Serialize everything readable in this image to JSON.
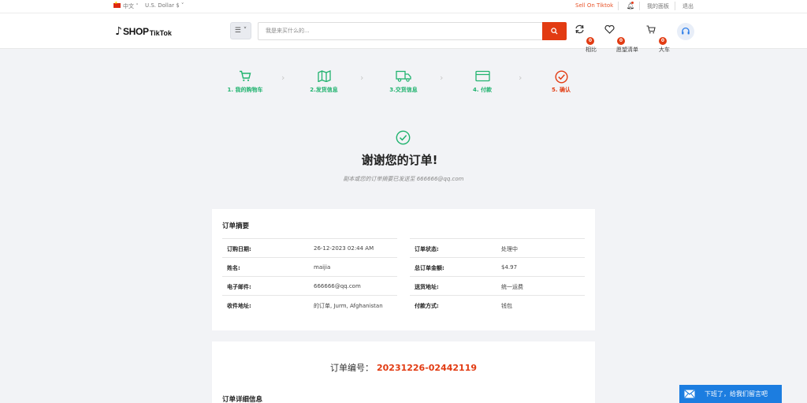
{
  "topbar": {
    "language": "中文 ˅",
    "currency": "U.S. Dollar $ ˅",
    "sell_on": "Sell On Tiktok",
    "my_panel": "我的面板",
    "logout": "退出"
  },
  "header": {
    "logo": {
      "icon": "♪",
      "shop": "SHOP",
      "tiktok": "TikTok"
    },
    "menu_button": "☰ ˅",
    "search_placeholder": "我是来买什么的...",
    "compare": {
      "label": "相比",
      "count": "0"
    },
    "wishlist": {
      "label": "愿望清单",
      "count": "0"
    },
    "cart": {
      "label": "大车",
      "count": "0"
    }
  },
  "steps": [
    {
      "label": "1. 我的购物车",
      "icon": "cart-icon",
      "color": "#21b36f"
    },
    {
      "label": "2.发货信息",
      "icon": "map-icon",
      "color": "#21b36f"
    },
    {
      "label": "3.交货信息",
      "icon": "truck-icon",
      "color": "#21b36f"
    },
    {
      "label": "4. 付款",
      "icon": "credit-card-icon",
      "color": "#21b36f"
    },
    {
      "label": "5. 确认",
      "icon": "check-circle-icon",
      "color": "#e23b12"
    }
  ],
  "thanks": {
    "title": "谢谢您的订单!",
    "subtitle": "副本或您的订单摘要已发送至 666666@qq.com"
  },
  "summary": {
    "title": "订单摘要",
    "left": [
      {
        "key": "订购日期:",
        "value": "26-12-2023 02:44 AM"
      },
      {
        "key": "姓名:",
        "value": "maijia"
      },
      {
        "key": "电子邮件:",
        "value": "666666@qq.com"
      },
      {
        "key": "收件地址:",
        "value": "的订单, Jurm, Afghanistan"
      }
    ],
    "right": [
      {
        "key": "订单状态:",
        "value": "处理中"
      },
      {
        "key": "总订单金额:",
        "value": "$4.97"
      },
      {
        "key": "送货地址:",
        "value": "统一运费"
      },
      {
        "key": "付款方式:",
        "value": "钱包"
      }
    ]
  },
  "order": {
    "number_label": "订单编号：",
    "number": "20231226-02442119",
    "details_title": "订单详细信息"
  },
  "chat": {
    "label": "下班了，给我们留言吧"
  },
  "colors": {
    "accent": "#e23b12",
    "success": "#21b36f",
    "chat": "#1c7de0"
  }
}
